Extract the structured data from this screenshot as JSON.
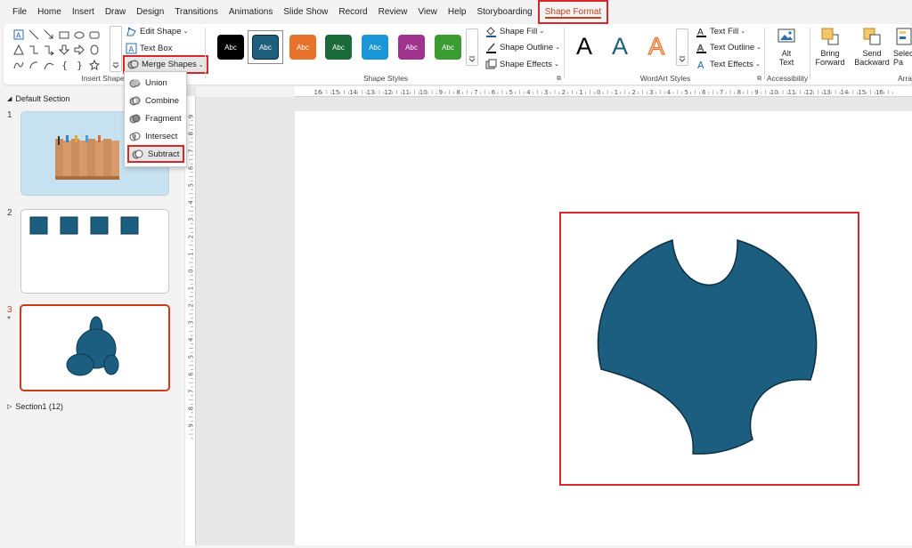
{
  "menu": {
    "tabs": [
      "File",
      "Home",
      "Insert",
      "Draw",
      "Design",
      "Transitions",
      "Animations",
      "Slide Show",
      "Record",
      "Review",
      "View",
      "Help",
      "Storyboarding",
      "Shape Format"
    ]
  },
  "ribbon": {
    "insert_shapes": {
      "label": "Insert Shapes",
      "edit_shape": "Edit Shape",
      "text_box": "Text Box",
      "merge_shapes": "Merge Shapes"
    },
    "shape_styles": {
      "label": "Shape Styles",
      "swatch_text": "Abc",
      "swatch_colors": [
        "#000000",
        "#1e5f7e",
        "#e8732c",
        "#1a6a3a",
        "#1a96d4",
        "#a0338e",
        "#3d9b34"
      ],
      "shape_fill": "Shape Fill",
      "shape_outline": "Shape Outline",
      "shape_effects": "Shape Effects"
    },
    "wordart": {
      "label": "WordArt Styles",
      "letter": "A",
      "text_fill": "Text Fill",
      "text_outline": "Text Outline",
      "text_effects": "Text Effects"
    },
    "accessibility": {
      "label": "Accessibility",
      "alt_text_1": "Alt",
      "alt_text_2": "Text"
    },
    "arrange": {
      "label": "Arra",
      "bring_forward_1": "Bring",
      "bring_forward_2": "Forward",
      "send_backward_1": "Send",
      "send_backward_2": "Backward",
      "selection_pane_1": "Selec",
      "selection_pane_2": "Pa"
    }
  },
  "merge_menu": {
    "items": [
      "Union",
      "Combine",
      "Fragment",
      "Intersect",
      "Subtract"
    ]
  },
  "thumbnails": {
    "default_section": "Default Section",
    "section1": "Section1 (12)",
    "slide_numbers": [
      "1",
      "2",
      "3"
    ],
    "slide3_star": "*"
  },
  "rulers": {
    "horizontal": [
      "16",
      "15",
      "14",
      "13",
      "12",
      "11",
      "10",
      "9",
      "8",
      "7",
      "6",
      "5",
      "4",
      "3",
      "2",
      "1",
      "0",
      "1",
      "2",
      "3",
      "4",
      "5",
      "6",
      "7",
      "8",
      "9",
      "10",
      "11",
      "12",
      "13",
      "14",
      "15",
      "16"
    ],
    "vertical": [
      "9",
      "8",
      "7",
      "6",
      "5",
      "4",
      "3",
      "2",
      "1",
      "0",
      "1",
      "2",
      "3",
      "4",
      "5",
      "6",
      "7",
      "8",
      "9"
    ]
  },
  "colors": {
    "shape_fill": "#1b5e80",
    "accent": "#c43e1c",
    "highlight_box": "#d62828"
  }
}
